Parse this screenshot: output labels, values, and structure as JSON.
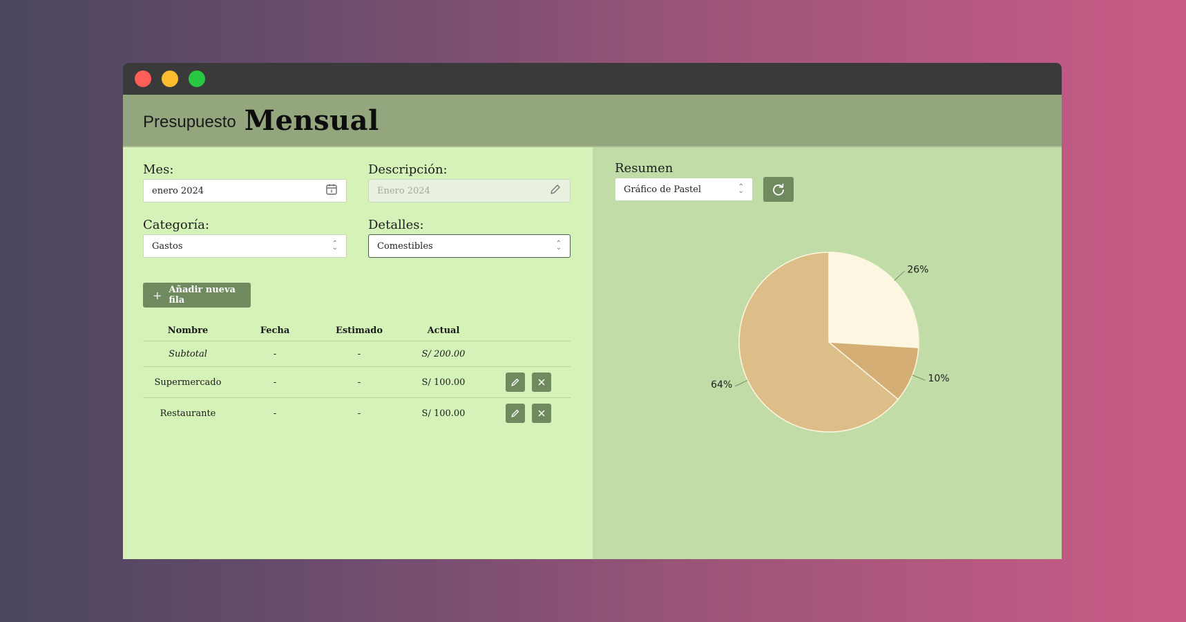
{
  "window": {
    "controls": {
      "close_color": "#ff5f57",
      "minimize_color": "#febc2e",
      "maximize_color": "#28c840"
    }
  },
  "header": {
    "title_prefix": "Presupuesto",
    "title_main": "Mensual"
  },
  "form": {
    "mes": {
      "label": "Mes:",
      "value": "enero 2024",
      "icon": "calendar-icon"
    },
    "descripcion": {
      "label": "Descripción:",
      "placeholder": "Enero 2024",
      "icon": "pencil-icon"
    },
    "categoria": {
      "label": "Categoría:",
      "value": "Gastos"
    },
    "detalles": {
      "label": "Detalles:",
      "value": "Comestibles"
    },
    "add_button": "Añadir nueva fila"
  },
  "table": {
    "headers": [
      "Nombre",
      "Fecha",
      "Estimado",
      "Actual"
    ],
    "subtotal": {
      "name": "Subtotal",
      "fecha": "-",
      "estimado": "-",
      "actual": "S/ 200.00"
    },
    "rows": [
      {
        "name": "Supermercado",
        "fecha": "-",
        "estimado": "-",
        "actual": "S/ 100.00"
      },
      {
        "name": "Restaurante",
        "fecha": "-",
        "estimado": "-",
        "actual": "S/ 100.00"
      }
    ]
  },
  "summary": {
    "label": "Resumen",
    "chart_type_value": "Gráfico de Pastel",
    "refresh_icon": "refresh-icon"
  },
  "chart_data": {
    "type": "pie",
    "values": [
      26,
      10,
      64
    ],
    "labels": [
      "26%",
      "10%",
      "64%"
    ],
    "colors": [
      "#fdf6e0",
      "#d4ae74",
      "#ddbd88"
    ],
    "title": ""
  }
}
